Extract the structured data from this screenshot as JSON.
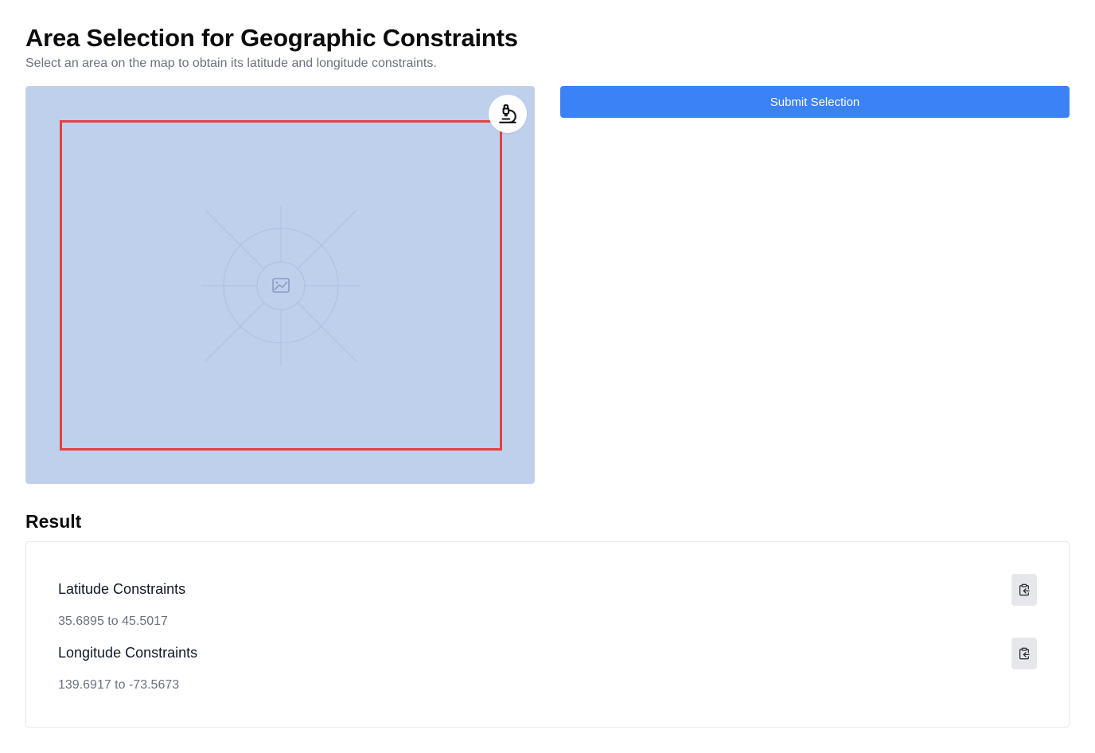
{
  "header": {
    "title": "Area Selection for Geographic Constraints",
    "subtitle": "Select an area on the map to obtain its latitude and longitude constraints."
  },
  "map": {
    "placeholder_icon": "image-icon",
    "tool_icon": "microscope-icon",
    "background_color": "#bfd0ed",
    "selection_color": "#e44141"
  },
  "actions": {
    "submit_label": "Submit Selection",
    "submit_color": "#3b82f6"
  },
  "result": {
    "heading": "Result",
    "latitude": {
      "title": "Latitude Constraints",
      "value": "35.6895 to 45.5017",
      "copy_icon": "clipboard-copy-icon"
    },
    "longitude": {
      "title": "Longitude Constraints",
      "value": "139.6917 to -73.5673",
      "copy_icon": "clipboard-copy-icon"
    }
  }
}
